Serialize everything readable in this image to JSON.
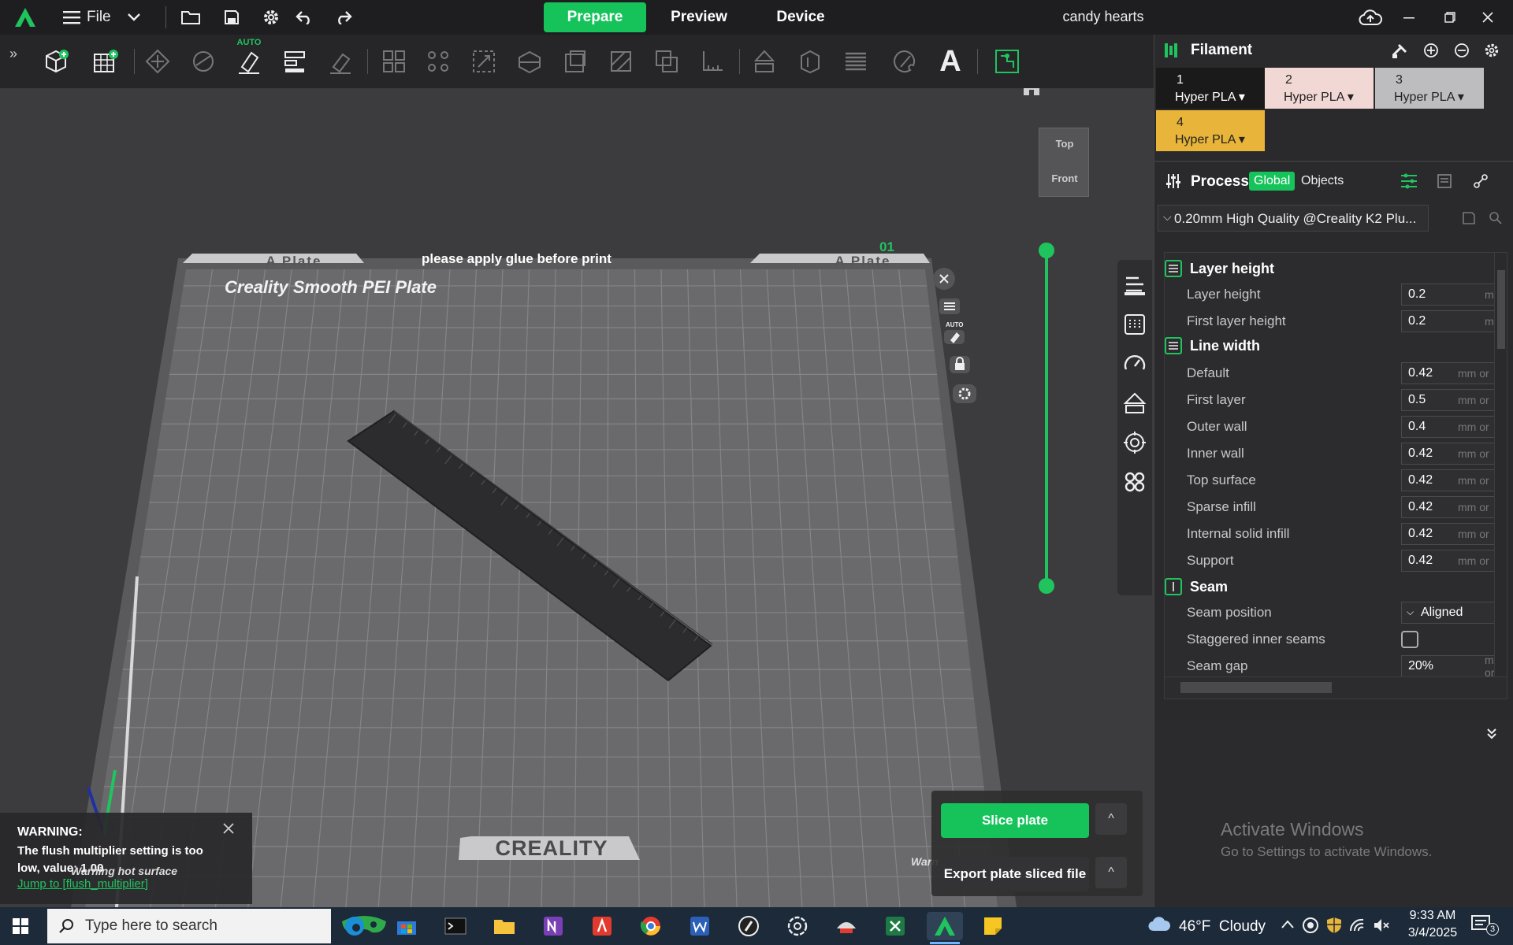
{
  "window": {
    "title": "candy hearts",
    "menu_file": "File"
  },
  "nav_tabs": [
    {
      "label": "Prepare",
      "active": true
    },
    {
      "label": "Preview",
      "active": false
    },
    {
      "label": "Device",
      "active": false
    }
  ],
  "toolbar": {
    "auto_badge": "AUTO",
    "text_tool": "A"
  },
  "view_cube": {
    "top": "Top",
    "front": "Front"
  },
  "plate": {
    "name_left": "A Plate",
    "name_right": "A Plate",
    "glue_note": "please apply glue before print",
    "plate_type": "Creality Smooth PEI Plate",
    "plate_number": "01",
    "brand": "CREALITY",
    "auto_badge": "AUTO"
  },
  "warning": {
    "title": "WARNING:",
    "message": "The flush multiplier setting is too low, value: 1.00",
    "link": "Jump to [flush_multiplier]",
    "hot_surface": "Warning hot surface",
    "hot_surface_right": "Warn"
  },
  "actions": {
    "slice_label": "Slice plate",
    "export_label": "Export plate sliced file",
    "caret": "^"
  },
  "filament": {
    "title": "Filament",
    "slots": [
      {
        "number": "1",
        "label": "Hyper PLA",
        "color": "#1a1a1a",
        "text_color": "#ffffff"
      },
      {
        "number": "2",
        "label": "Hyper PLA",
        "color": "#f2d8d5",
        "text_color": "#222222"
      },
      {
        "number": "3",
        "label": "Hyper PLA",
        "color": "#bdbdbf",
        "text_color": "#222222"
      },
      {
        "number": "4",
        "label": "Hyper PLA",
        "color": "#e8b53a",
        "text_color": "#222222"
      }
    ]
  },
  "process": {
    "title": "Process",
    "tab_global": "Global",
    "tab_objects": "Objects",
    "preset": "0.20mm High Quality @Creality K2 Plu..."
  },
  "params": {
    "layer_height_group": "Layer height",
    "layer_height": {
      "label": "Layer height",
      "value": "0.2",
      "unit": "mm"
    },
    "first_layer_height": {
      "label": "First layer height",
      "value": "0.2",
      "unit": "mm"
    },
    "line_width_group": "Line width",
    "line_width": [
      {
        "label": "Default",
        "value": "0.42",
        "unit": "mm or"
      },
      {
        "label": "First layer",
        "value": "0.5",
        "unit": "mm or"
      },
      {
        "label": "Outer wall",
        "value": "0.4",
        "unit": "mm or"
      },
      {
        "label": "Inner wall",
        "value": "0.42",
        "unit": "mm or"
      },
      {
        "label": "Top surface",
        "value": "0.42",
        "unit": "mm or"
      },
      {
        "label": "Sparse infill",
        "value": "0.42",
        "unit": "mm or"
      },
      {
        "label": "Internal solid infill",
        "value": "0.42",
        "unit": "mm or"
      },
      {
        "label": "Support",
        "value": "0.42",
        "unit": "mm or"
      }
    ],
    "seam_group": "Seam",
    "seam_position": {
      "label": "Seam position",
      "value": "Aligned"
    },
    "staggered": {
      "label": "Staggered inner seams",
      "checked": false
    },
    "seam_gap": {
      "label": "Seam gap",
      "value": "20%",
      "unit": "mm or"
    }
  },
  "activate": {
    "title": "Activate Windows",
    "subtitle": "Go to Settings to activate Windows."
  },
  "taskbar": {
    "search_placeholder": "Type here to search",
    "weather": "46°F  Cloudy",
    "time": "9:33 AM",
    "date": "3/4/2025",
    "notifications": "3"
  },
  "colors": {
    "accent": "#16c35b",
    "topbar": "#1e1e20",
    "panel": "#2a2a2c",
    "viewport": "#3c3c3e",
    "bed": "#6a6a6c"
  }
}
